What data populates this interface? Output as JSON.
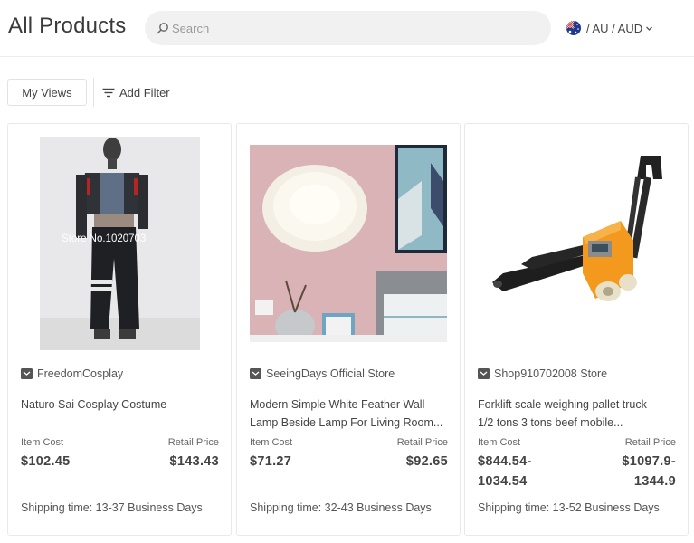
{
  "header": {
    "title": "All Products",
    "search_placeholder": "Search",
    "region_label": "/ AU / AUD"
  },
  "toolbar": {
    "views_label": "My Views",
    "filter_label": "Add Filter"
  },
  "products": [
    {
      "store": "FreedomCosplay",
      "title_lines": [
        "Naturo Sai Cosplay Costume"
      ],
      "cost_label": "Item Cost",
      "retail_label": "Retail Price",
      "cost_lines": [
        "$102.45"
      ],
      "retail_lines": [
        "$143.43"
      ],
      "shipping": "Shipping time: 13-37 Business Days",
      "image_watermark": "Store No.1020703"
    },
    {
      "store": "SeeingDays Official Store",
      "title_lines": [
        "Modern Simple White Feather Wall",
        "Lamp Beside Lamp For Living Room..."
      ],
      "cost_label": "Item Cost",
      "retail_label": "Retail Price",
      "cost_lines": [
        "$71.27"
      ],
      "retail_lines": [
        "$92.65"
      ],
      "shipping": "Shipping time: 32-43 Business Days"
    },
    {
      "store": "Shop910702008 Store",
      "title_lines": [
        "Forklift scale weighing pallet truck",
        "1/2 tons 3 tons beef mobile..."
      ],
      "cost_label": "Item Cost",
      "retail_label": "Retail Price",
      "cost_lines": [
        "$844.54-",
        "1034.54"
      ],
      "retail_lines": [
        "$1097.9-",
        "1344.9"
      ],
      "shipping": "Shipping time: 13-52 Business Days"
    }
  ],
  "colors": {
    "search_bg": "#f1f1f1",
    "border": "#e9e9e9",
    "text": "#444444"
  }
}
